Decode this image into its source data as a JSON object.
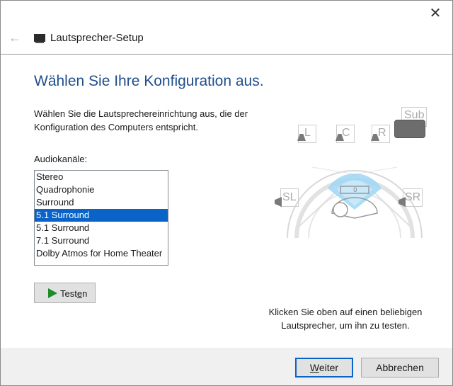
{
  "window": {
    "title": "Lautsprecher-Setup",
    "close_icon": "close-icon",
    "back_icon": "back-arrow-icon",
    "app_icon": "speaker-icon"
  },
  "main": {
    "heading": "Wählen Sie Ihre Konfiguration aus.",
    "description": "Wählen Sie die Lautsprechereinrichtung aus, die der Konfiguration des Computers entspricht.",
    "channels_label": "Audiokanäle:",
    "channels": [
      {
        "label": "Stereo",
        "selected": false
      },
      {
        "label": "Quadrophonie",
        "selected": false
      },
      {
        "label": "Surround",
        "selected": false
      },
      {
        "label": "5.1 Surround",
        "selected": true
      },
      {
        "label": "5.1 Surround",
        "selected": false
      },
      {
        "label": "7.1 Surround",
        "selected": false
      },
      {
        "label": "Dolby Atmos for Home Theater",
        "selected": false
      }
    ],
    "test_button": {
      "prefix": "Test",
      "mnemonic": "e",
      "suffix": "n"
    }
  },
  "diagram": {
    "speakers": {
      "left": "L",
      "center": "C",
      "right": "R",
      "sub": "Sub",
      "surround_left": "SL",
      "surround_right": "SR"
    }
  },
  "hint": "Klicken Sie oben auf einen beliebigen Lautsprecher, um ihn zu testen.",
  "footer": {
    "next_button": {
      "mnemonic": "W",
      "rest": "eiter"
    },
    "cancel_button": "Abbrechen"
  },
  "colors": {
    "accent": "#0a64c8",
    "heading": "#1f4e8c",
    "diagram_highlight": "#9fd6f5"
  }
}
